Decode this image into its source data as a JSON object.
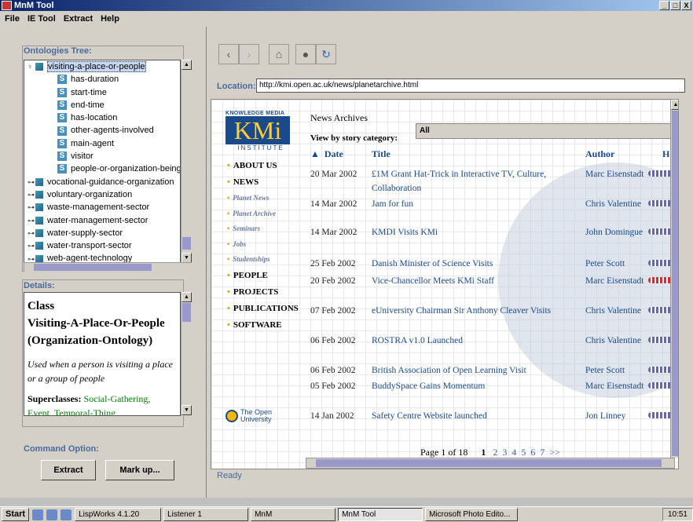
{
  "window": {
    "title": "MnM Tool",
    "buttons": [
      "_",
      "□",
      "X"
    ]
  },
  "menu": [
    "File",
    "IE Tool",
    "Extract",
    "Help"
  ],
  "ontology": {
    "title": "Ontologies Tree:",
    "nodes": [
      {
        "label": "visiting-a-place-or-people",
        "kind": "class",
        "expanded": true
      },
      {
        "label": "has-duration",
        "kind": "slot"
      },
      {
        "label": "start-time",
        "kind": "slot"
      },
      {
        "label": "end-time",
        "kind": "slot"
      },
      {
        "label": "has-location",
        "kind": "slot"
      },
      {
        "label": "other-agents-involved",
        "kind": "slot"
      },
      {
        "label": "main-agent",
        "kind": "slot"
      },
      {
        "label": "visitor",
        "kind": "slot"
      },
      {
        "label": "people-or-organization-being-v",
        "kind": "slot"
      },
      {
        "label": "vocational-guidance-organization",
        "kind": "class"
      },
      {
        "label": "voluntary-organization",
        "kind": "class"
      },
      {
        "label": "waste-management-sector",
        "kind": "class"
      },
      {
        "label": "water-management-sector",
        "kind": "class"
      },
      {
        "label": "water-supply-sector",
        "kind": "class"
      },
      {
        "label": "water-transport-sector",
        "kind": "class"
      },
      {
        "label": "web-agent-technology",
        "kind": "class"
      }
    ]
  },
  "details": {
    "title": "Details:",
    "class_line1": "Class",
    "class_line2": "Visiting-A-Place-Or-People",
    "class_line3": "(Organization-Ontology)",
    "description": "Used when a person is visiting a place or a group of people",
    "superclasses_label": "Superclasses:",
    "superclasses": "Social-Gathering, Event, Temporal-Thing"
  },
  "command": {
    "title": "Command Option:",
    "extract": "Extract",
    "markup": "Mark up..."
  },
  "browser": {
    "location_label": "Location:",
    "location_value": "http://kmi.open.ac.uk/news/planetarchive.html",
    "status": "Ready",
    "logo": {
      "top": "KNOWLEDGE MEDIA",
      "big": "KMi",
      "bottom": "INSTITUTE"
    },
    "nav": [
      {
        "label": "ABOUT US",
        "type": "main"
      },
      {
        "label": "NEWS",
        "type": "main"
      },
      {
        "label": "Planet News",
        "type": "sub"
      },
      {
        "label": "Planet Archive",
        "type": "sub"
      },
      {
        "label": "Seminars",
        "type": "sub"
      },
      {
        "label": "Jobs",
        "type": "sub"
      },
      {
        "label": "Studentships",
        "type": "sub"
      },
      {
        "label": "PEOPLE",
        "type": "main"
      },
      {
        "label": "PROJECTS",
        "type": "main"
      },
      {
        "label": "PUBLICATIONS",
        "type": "main"
      },
      {
        "label": "SOFTWARE",
        "type": "main"
      }
    ],
    "ou_logo": {
      "line1": "The Open",
      "line2": "University"
    },
    "heading": "News Archives",
    "viewby": "View by story category:",
    "category_selected": "All",
    "columns": {
      "date": "Date",
      "title": "Title",
      "author": "Author",
      "how": "Ho"
    },
    "sort_arrow": "▲",
    "rows": [
      {
        "date": "20 Mar 2002",
        "title": "£1M Grant Hat-Trick in Interactive TV, Culture, Collaboration",
        "author": "Marc Eisenstadt"
      },
      {
        "date": "14 Mar 2002",
        "title": "Jam for fun",
        "author": "Chris Valentine"
      },
      {
        "date": "14 Mar 2002",
        "title": "KMDI Visits KMi",
        "author": "John Domingue"
      },
      {
        "date": "25 Feb 2002",
        "title": "Danish Minister of Science Visits",
        "author": "Peter Scott"
      },
      {
        "date": "20 Feb 2002",
        "title": "Vice-Chancellor Meets KMi Staff",
        "author": "Marc Eisenstadt"
      },
      {
        "date": "07 Feb 2002",
        "title": "eUniversity Chairman Sir Anthony Cleaver Visits",
        "author": "Chris Valentine"
      },
      {
        "date": "06 Feb 2002",
        "title": "ROSTRA v1.0 Launched",
        "author": "Chris Valentine"
      },
      {
        "date": "06 Feb 2002",
        "title": "British Association of Open Learning Visit",
        "author": "Peter Scott"
      },
      {
        "date": "05 Feb 2002",
        "title": "BuddySpace Gains Momentum",
        "author": "Marc Eisenstadt"
      },
      {
        "date": "14 Jan 2002",
        "title": "Safety Centre Website launched",
        "author": "Jon Linney"
      }
    ],
    "pager": {
      "text": "Page 1 of 18",
      "current": "1",
      "links": [
        "2",
        "3",
        "4",
        "5",
        "6",
        "7",
        ">>"
      ]
    }
  },
  "taskbar": {
    "start": "Start",
    "tasks": [
      "LispWorks 4.1.20",
      "Listener 1",
      "MnM",
      "MnM Tool",
      "Microsoft Photo Edito..."
    ],
    "active": "MnM Tool",
    "clock": "10:51"
  }
}
